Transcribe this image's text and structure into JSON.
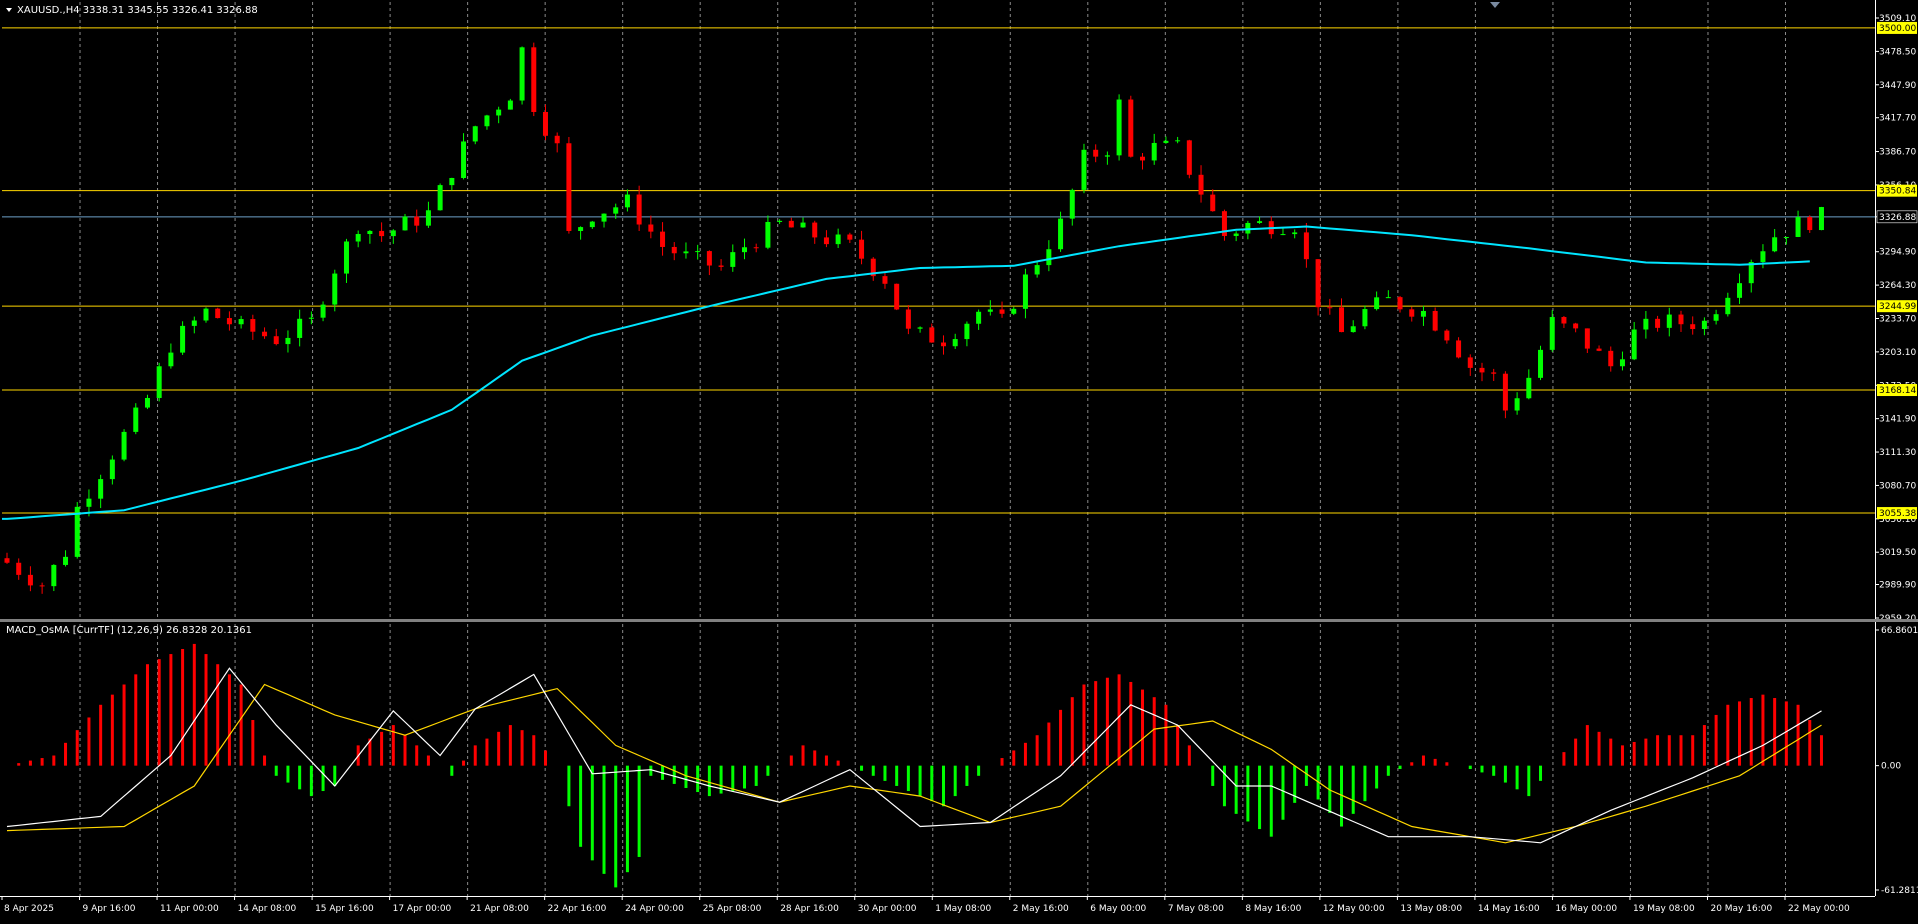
{
  "window": {
    "price_header": "XAUUSD.,H4  3338.31 3345.55 3326.41 3326.88",
    "macd_header": "MACD_OsMA [CurrTF] (12,26,9) 26.8328 20.1361"
  },
  "colors": {
    "background": "#000000",
    "bull_candle": "#00ff00",
    "bear_candle": "#ff0000",
    "moving_average": "#00e5ff",
    "level_line": "#ffd700",
    "level_label_bg": "#ffff00",
    "grid": "#8a8a8a",
    "axis_text": "#ffffff",
    "macd_line": "#ffffff",
    "signal_line": "#ffd700",
    "hist_positive": "#ff0000",
    "hist_negative": "#00ff00",
    "current_price_line": "#6ea0c8"
  },
  "chart_data": [
    {
      "type": "candlestick",
      "symbol": "XAUUSD.",
      "timeframe": "H4",
      "ohlc_readout": {
        "open": 3338.31,
        "high": 3345.55,
        "low": 3326.41,
        "close": 3326.88
      },
      "ylim": [
        2959.2,
        3509.1
      ],
      "y_ticks": [
        "3509.10",
        "3478.50",
        "3447.90",
        "3417.70",
        "3386.70",
        "3356.10",
        "3326.88",
        "3294.90",
        "3264.30",
        "3233.70",
        "3203.10",
        "3172.50",
        "3141.90",
        "3111.30",
        "3080.70",
        "3050.10",
        "3019.50",
        "2989.90",
        "2959.20"
      ],
      "x_labels": [
        "8 Apr 2025",
        "9 Apr 16:00",
        "11 Apr 00:00",
        "14 Apr 08:00",
        "15 Apr 16:00",
        "17 Apr 00:00",
        "21 Apr 08:00",
        "22 Apr 16:00",
        "24 Apr 00:00",
        "25 Apr 08:00",
        "28 Apr 16:00",
        "30 Apr 00:00",
        "1 May 08:00",
        "2 May 16:00",
        "6 May 00:00",
        "7 May 08:00",
        "8 May 16:00",
        "12 May 00:00",
        "13 May 08:00",
        "14 May 16:00",
        "16 May 00:00",
        "19 May 08:00",
        "20 May 16:00",
        "22 May 00:00"
      ],
      "levels": [
        {
          "label": "3500.00",
          "value": 3500.0
        },
        {
          "label": "3350.84",
          "value": 3350.84
        },
        {
          "label": "3244.99",
          "value": 3244.99
        },
        {
          "label": "3168.14",
          "value": 3168.14
        },
        {
          "label": "3055.38",
          "value": 3055.38
        }
      ],
      "current_price": {
        "label": "3326.88",
        "value": 3326.88
      },
      "close_path": [
        [
          0,
          3010
        ],
        [
          3,
          2990
        ],
        [
          5,
          3020
        ],
        [
          6,
          3060
        ],
        [
          9,
          3110
        ],
        [
          12,
          3160
        ],
        [
          14,
          3210
        ],
        [
          17,
          3240
        ],
        [
          20,
          3225
        ],
        [
          23,
          3215
        ],
        [
          26,
          3230
        ],
        [
          28,
          3280
        ],
        [
          30,
          3320
        ],
        [
          32,
          3310
        ],
        [
          36,
          3330
        ],
        [
          40,
          3410
        ],
        [
          43,
          3440
        ],
        [
          44,
          3480
        ],
        [
          45,
          3430
        ],
        [
          47,
          3390
        ],
        [
          48,
          3310
        ],
        [
          50,
          3330
        ],
        [
          53,
          3340
        ],
        [
          56,
          3300
        ],
        [
          58,
          3290
        ],
        [
          61,
          3280
        ],
        [
          63,
          3300
        ],
        [
          66,
          3320
        ],
        [
          69,
          3310
        ],
        [
          72,
          3300
        ],
        [
          75,
          3270
        ],
        [
          77,
          3220
        ],
        [
          80,
          3215
        ],
        [
          83,
          3240
        ],
        [
          85,
          3230
        ],
        [
          87,
          3270
        ],
        [
          90,
          3320
        ],
        [
          92,
          3380
        ],
        [
          94,
          3390
        ],
        [
          95,
          3430
        ],
        [
          96,
          3380
        ],
        [
          98,
          3390
        ],
        [
          100,
          3390
        ],
        [
          102,
          3350
        ],
        [
          104,
          3310
        ],
        [
          106,
          3320
        ],
        [
          108,
          3320
        ],
        [
          110,
          3320
        ],
        [
          112,
          3250
        ],
        [
          114,
          3220
        ],
        [
          116,
          3240
        ],
        [
          118,
          3250
        ],
        [
          121,
          3240
        ],
        [
          123,
          3220
        ],
        [
          125,
          3190
        ],
        [
          127,
          3180
        ],
        [
          128,
          3150
        ],
        [
          130,
          3180
        ],
        [
          132,
          3230
        ],
        [
          134,
          3220
        ],
        [
          136,
          3200
        ],
        [
          137,
          3190
        ],
        [
          139,
          3220
        ],
        [
          141,
          3230
        ],
        [
          143,
          3230
        ],
        [
          145,
          3230
        ],
        [
          147,
          3260
        ],
        [
          149,
          3290
        ],
        [
          151,
          3310
        ],
        [
          153,
          3320
        ],
        [
          155,
          3326.88
        ]
      ],
      "moving_average_path": [
        [
          0,
          3050
        ],
        [
          10,
          3058
        ],
        [
          20,
          3085
        ],
        [
          30,
          3115
        ],
        [
          38,
          3150
        ],
        [
          44,
          3195
        ],
        [
          50,
          3218
        ],
        [
          60,
          3245
        ],
        [
          70,
          3270
        ],
        [
          78,
          3280
        ],
        [
          86,
          3282
        ],
        [
          95,
          3300
        ],
        [
          105,
          3315
        ],
        [
          111,
          3318
        ],
        [
          120,
          3310
        ],
        [
          130,
          3298
        ],
        [
          140,
          3285
        ],
        [
          148,
          3283
        ],
        [
          154,
          3286
        ]
      ]
    },
    {
      "type": "macd",
      "name": "MACD_OsMA [CurrTF] (12,26,9)",
      "params": [
        12,
        26,
        9
      ],
      "readout": {
        "macd": 26.8328,
        "signal": 20.1361
      },
      "ylim": [
        -61.2811,
        66.8601
      ],
      "y_ticks": [
        "66.8601",
        "0.00",
        "-61.2811"
      ],
      "macd_path": [
        [
          0,
          -30
        ],
        [
          8,
          -25
        ],
        [
          14,
          5
        ],
        [
          19,
          48
        ],
        [
          23,
          20
        ],
        [
          28,
          -10
        ],
        [
          33,
          27
        ],
        [
          37,
          5
        ],
        [
          40,
          28
        ],
        [
          45,
          45
        ],
        [
          50,
          -4
        ],
        [
          55,
          -2
        ],
        [
          60,
          -10
        ],
        [
          66,
          -18
        ],
        [
          72,
          -2
        ],
        [
          78,
          -30
        ],
        [
          84,
          -28
        ],
        [
          90,
          -5
        ],
        [
          96,
          30
        ],
        [
          100,
          20
        ],
        [
          105,
          -10
        ],
        [
          108,
          -10
        ],
        [
          112,
          -20
        ],
        [
          118,
          -35
        ],
        [
          125,
          -35
        ],
        [
          131,
          -38
        ],
        [
          137,
          -22
        ],
        [
          144,
          -6
        ],
        [
          150,
          10
        ],
        [
          155,
          27
        ]
      ],
      "signal_path": [
        [
          0,
          -32
        ],
        [
          10,
          -30
        ],
        [
          16,
          -10
        ],
        [
          22,
          40
        ],
        [
          28,
          25
        ],
        [
          34,
          15
        ],
        [
          40,
          28
        ],
        [
          47,
          38
        ],
        [
          52,
          10
        ],
        [
          58,
          -5
        ],
        [
          66,
          -18
        ],
        [
          72,
          -10
        ],
        [
          78,
          -15
        ],
        [
          84,
          -28
        ],
        [
          90,
          -20
        ],
        [
          98,
          18
        ],
        [
          103,
          22
        ],
        [
          108,
          8
        ],
        [
          113,
          -12
        ],
        [
          120,
          -30
        ],
        [
          128,
          -38
        ],
        [
          134,
          -30
        ],
        [
          140,
          -20
        ],
        [
          148,
          -5
        ],
        [
          155,
          20
        ]
      ],
      "histogram_path": [
        [
          0,
          0
        ],
        [
          4,
          5
        ],
        [
          8,
          30
        ],
        [
          12,
          50
        ],
        [
          16,
          60
        ],
        [
          20,
          40
        ],
        [
          22,
          5
        ],
        [
          23,
          -5
        ],
        [
          26,
          -15
        ],
        [
          28,
          -10
        ],
        [
          30,
          10
        ],
        [
          33,
          20
        ],
        [
          36,
          5
        ],
        [
          38,
          -5
        ],
        [
          40,
          10
        ],
        [
          43,
          20
        ],
        [
          45,
          15
        ],
        [
          47,
          0
        ],
        [
          49,
          -40
        ],
        [
          52,
          -60
        ],
        [
          54,
          -45
        ],
        [
          55,
          -5
        ],
        [
          60,
          -15
        ],
        [
          64,
          -10
        ],
        [
          66,
          0
        ],
        [
          68,
          10
        ],
        [
          72,
          0
        ],
        [
          76,
          -10
        ],
        [
          80,
          -20
        ],
        [
          84,
          0
        ],
        [
          88,
          15
        ],
        [
          92,
          40
        ],
        [
          95,
          45
        ],
        [
          99,
          30
        ],
        [
          102,
          0
        ],
        [
          104,
          -20
        ],
        [
          108,
          -35
        ],
        [
          111,
          -10
        ],
        [
          114,
          -30
        ],
        [
          118,
          -5
        ],
        [
          121,
          5
        ],
        [
          124,
          0
        ],
        [
          127,
          -5
        ],
        [
          130,
          -15
        ],
        [
          132,
          0
        ],
        [
          135,
          20
        ],
        [
          138,
          10
        ],
        [
          141,
          15
        ],
        [
          144,
          15
        ],
        [
          147,
          30
        ],
        [
          150,
          35
        ],
        [
          153,
          30
        ],
        [
          155,
          15
        ]
      ]
    }
  ]
}
